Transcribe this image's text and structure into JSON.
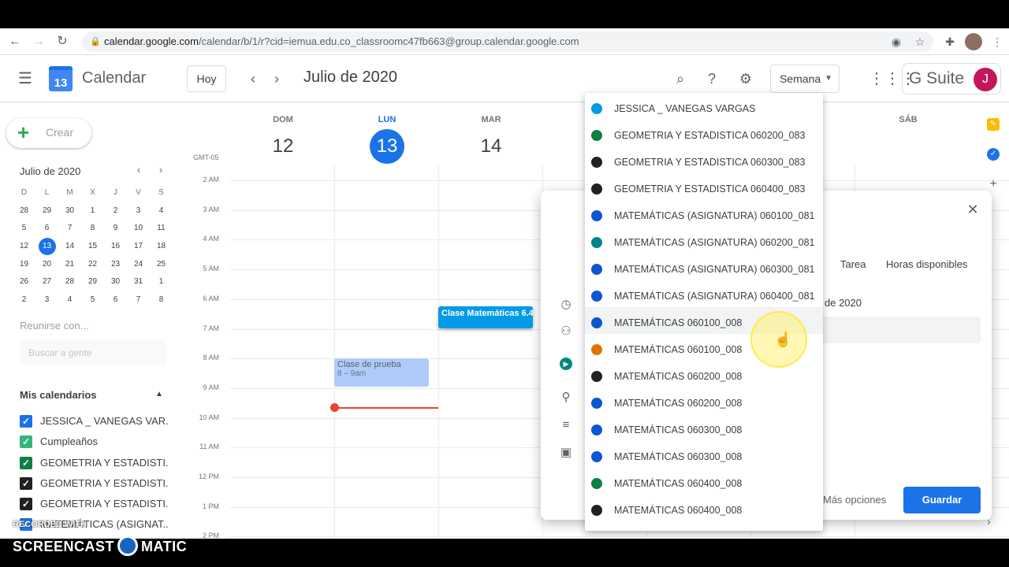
{
  "browser": {
    "url_host": "calendar.google.com",
    "url_path": "/calendar/b/1/r?cid=iemua.edu.co_classroomc47fb663@group.calendar.google.com"
  },
  "header": {
    "app_title": "Calendar",
    "logo_day": "13",
    "today_label": "Hoy",
    "date_title": "Julio de 2020",
    "view_label": "Semana",
    "gsuite_label": "G Suite",
    "user_initial": "J"
  },
  "sidebar": {
    "create_label": "Crear",
    "mini_month": "Julio de 2020",
    "mini_heads": [
      "D",
      "L",
      "M",
      "X",
      "J",
      "V",
      "S"
    ],
    "mini_weeks": [
      [
        "28",
        "29",
        "30",
        "1",
        "2",
        "3",
        "4"
      ],
      [
        "5",
        "6",
        "7",
        "8",
        "9",
        "10",
        "11"
      ],
      [
        "12",
        "13",
        "14",
        "15",
        "16",
        "17",
        "18"
      ],
      [
        "19",
        "20",
        "21",
        "22",
        "23",
        "24",
        "25"
      ],
      [
        "26",
        "27",
        "28",
        "29",
        "30",
        "31",
        "1"
      ],
      [
        "2",
        "3",
        "4",
        "5",
        "6",
        "7",
        "8"
      ]
    ],
    "meet_title": "Reunirse con...",
    "people_placeholder": "Buscar a gente",
    "my_calendars_title": "Mis calendarios",
    "calendars": [
      {
        "label": "JESSICA _ VANEGAS VAR...",
        "color": "#1a73e8"
      },
      {
        "label": "Cumpleaños",
        "color": "#33b679"
      },
      {
        "label": "GEOMETRIA Y ESTADISTI...",
        "color": "#0b8043"
      },
      {
        "label": "GEOMETRIA Y ESTADISTI...",
        "color": "#202124"
      },
      {
        "label": "GEOMETRIA Y ESTADISTI...",
        "color": "#202124"
      },
      {
        "label": "MATEMÁTICAS (ASIGNAT...",
        "color": "#1a73e8"
      }
    ]
  },
  "week": {
    "days": [
      {
        "name": "DOM",
        "num": "12"
      },
      {
        "name": "LUN",
        "num": "13"
      },
      {
        "name": "MAR",
        "num": "14"
      },
      {
        "name": "SÁB",
        "num": ""
      }
    ],
    "timezone": "GMT-05",
    "hours": [
      "2 AM",
      "3 AM",
      "4 AM",
      "5 AM",
      "6 AM",
      "7 AM",
      "8 AM",
      "9 AM",
      "10 AM",
      "11 AM",
      "12 PM",
      "1 PM",
      "2 PM"
    ],
    "events": {
      "trial_title": "Clase de prueba",
      "trial_time": "8 – 9am",
      "math_title": "Clase Matemáticas 6.4"
    }
  },
  "dialog": {
    "tab_task": "Tarea",
    "tab_availability": "Horas disponibles",
    "date_fragment": "de 2020",
    "more_options": "Más opciones",
    "save_label": "Guardar"
  },
  "dropdown": {
    "items": [
      {
        "label": "JESSICA _ VANEGAS VARGAS",
        "color": "#039be5"
      },
      {
        "label": "GEOMETRIA Y ESTADISTICA 060200_083",
        "color": "#0b8043"
      },
      {
        "label": "GEOMETRIA Y ESTADISTICA 060300_083",
        "color": "#202124"
      },
      {
        "label": "GEOMETRIA Y ESTADISTICA 060400_083",
        "color": "#202124"
      },
      {
        "label": "MATEMÁTICAS (ASIGNATURA) 060100_081",
        "color": "#0b57d0"
      },
      {
        "label": "MATEMÁTICAS (ASIGNATURA) 060200_081",
        "color": "#00838f"
      },
      {
        "label": "MATEMÁTICAS (ASIGNATURA) 060300_081",
        "color": "#0b57d0"
      },
      {
        "label": "MATEMÁTICAS (ASIGNATURA) 060400_081",
        "color": "#0b57d0"
      },
      {
        "label": "MATEMÁTICAS 060100_008",
        "color": "#0b57d0"
      },
      {
        "label": "MATEMÁTICAS 060100_008",
        "color": "#e37400"
      },
      {
        "label": "MATEMÁTICAS 060200_008",
        "color": "#202124"
      },
      {
        "label": "MATEMÁTICAS 060200_008",
        "color": "#0b57d0"
      },
      {
        "label": "MATEMÁTICAS 060300_008",
        "color": "#0b57d0"
      },
      {
        "label": "MATEMÁTICAS 060300_008",
        "color": "#0b57d0"
      },
      {
        "label": "MATEMÁTICAS 060400_008",
        "color": "#0b8043"
      },
      {
        "label": "MATEMÁTICAS 060400_008",
        "color": "#202124"
      }
    ]
  },
  "watermark": {
    "recorded": "RECORDED WITH",
    "brand_left": "SCREENCAST",
    "brand_right": "MATIC"
  }
}
